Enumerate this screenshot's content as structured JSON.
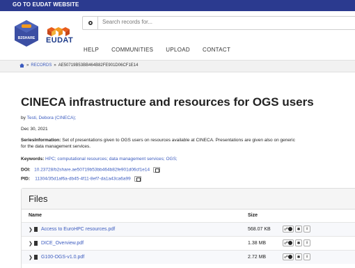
{
  "topbar": {
    "link": "GO TO EUDAT WEBSITE"
  },
  "header": {
    "b2share_text": "B2SHARE",
    "eudat_text": "EUDAT",
    "search_placeholder": "Search records for...",
    "nav": [
      "HELP",
      "COMMUNITIES",
      "UPLOAD",
      "CONTACT"
    ]
  },
  "breadcrumb": {
    "home_icon": "home-icon",
    "records": "RECORDS",
    "sep": "»",
    "record_id": "AE50719B53BB464B82FE901D06CF1E14"
  },
  "record": {
    "title": "CINECA infrastructure and resources for OGS users",
    "by_label": "by",
    "author": "Testi, Debora (CINECA);",
    "date": "Dec 30, 2021",
    "series_label": "SeriesInformation:",
    "series_text": "Set of presentations given to OGS users on resources available at CINECA. Presentations are given also on generic",
    "series_text2": "for the data management services.",
    "keywords_label": "Keywords:",
    "keywords": "HPC; computational resources; data management services; OGS;",
    "doi_label": "DOI:",
    "doi": "10.23728/b2share.ae50719b53bb464b82fe901d06cf1e14",
    "pid_label": "PID:",
    "pid": "11304/35d1af6a-db45-4f11-8ef7-da1a43ca6a99"
  },
  "files": {
    "title": "Files",
    "col_name": "Name",
    "col_size": "Size",
    "rows": [
      {
        "name": "Access to EuroHPC resources.pdf",
        "size": "568.07 KB"
      },
      {
        "name": "DICE_Overview.pdf",
        "size": "1.38 MB"
      },
      {
        "name": "G100-OGS-v1.0.pdf",
        "size": "2.72 MB"
      }
    ]
  },
  "colors": {
    "topbar": "#2b3a8f",
    "link": "#3b5bbf",
    "pid": "#c9302c"
  }
}
